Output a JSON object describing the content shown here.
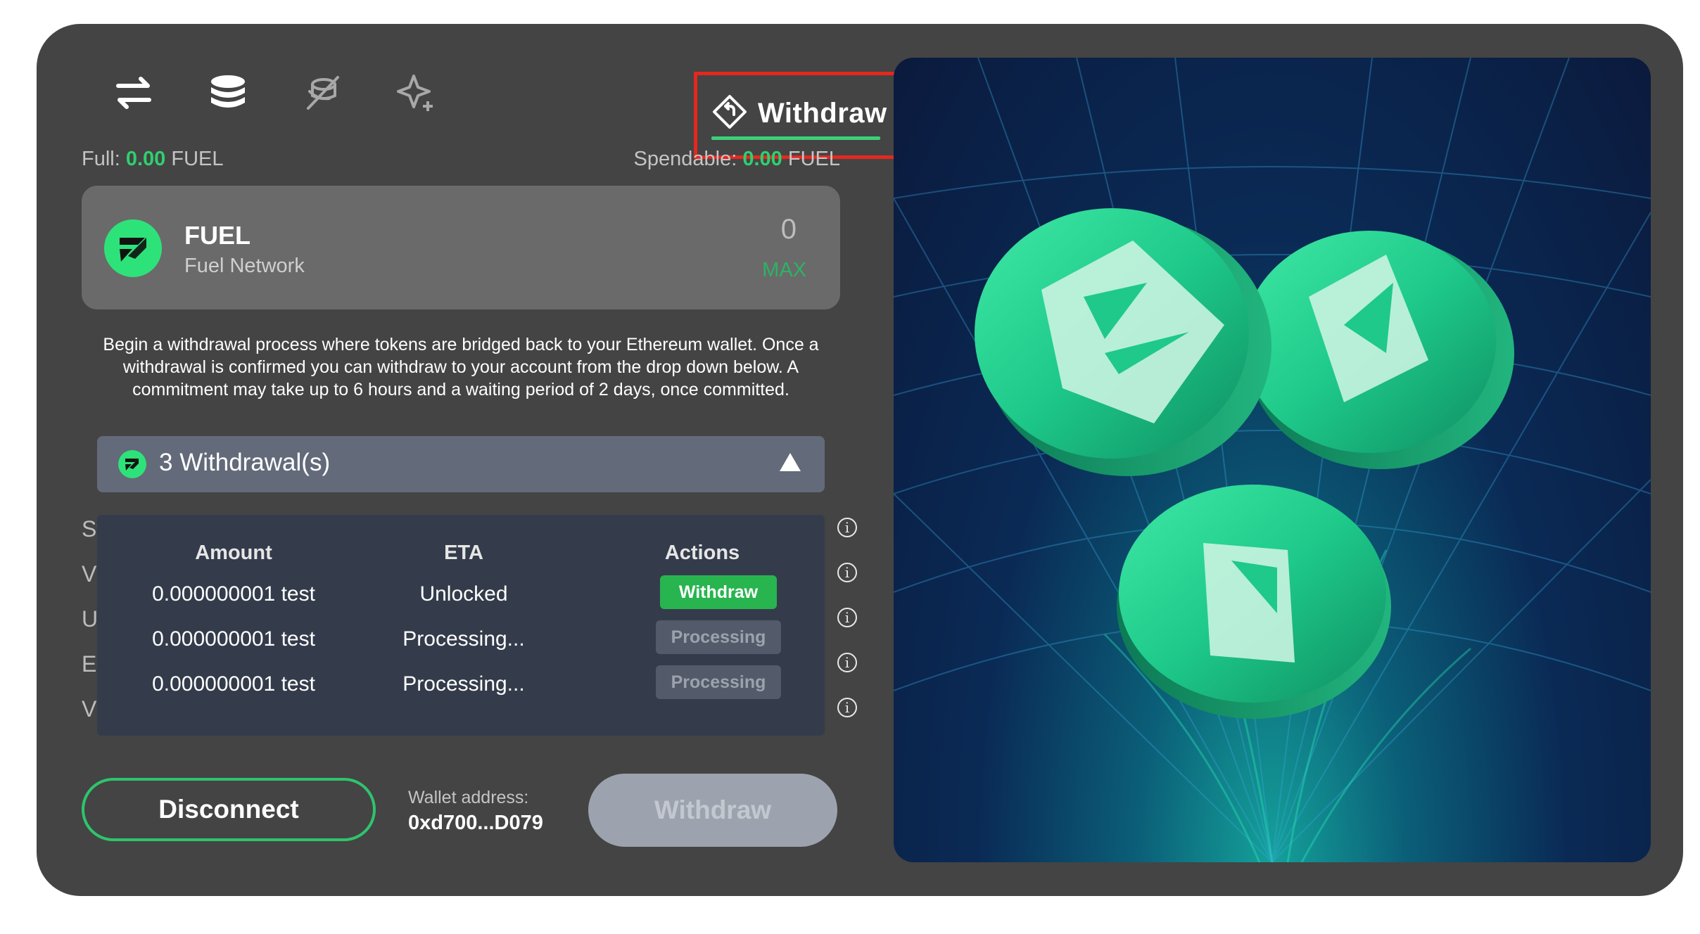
{
  "tabs": [
    {
      "icon": "swap-arrows-icon"
    },
    {
      "icon": "coin-stack-icon"
    },
    {
      "icon": "slashed-coins-icon"
    },
    {
      "icon": "sparkle-star-icon"
    },
    {
      "icon": "withdraw-diamond-icon",
      "label": "Withdraw",
      "active": true
    }
  ],
  "balances": {
    "full_label": "Full:",
    "full_value": "0.00",
    "full_unit": "FUEL",
    "spendable_label": "Spendable:",
    "spendable_value": "0.00",
    "spendable_unit": "FUEL"
  },
  "token": {
    "name": "FUEL",
    "network": "Fuel Network",
    "amount": "0",
    "max_label": "MAX"
  },
  "description": "Begin a withdrawal process where tokens are bridged back to your Ethereum wallet. Once a withdrawal is confirmed you can withdraw to your account from the drop down below. A commitment may take up to 6 hours and a waiting period of 2 days, once committed.",
  "withdrawals_dropdown": {
    "label": "3 Withdrawal(s)",
    "expanded": true
  },
  "background_rows": [
    "St",
    "V",
    "U",
    "Es",
    "V"
  ],
  "withdrawals_table": {
    "headers": {
      "amount": "Amount",
      "eta": "ETA",
      "actions": "Actions"
    },
    "rows": [
      {
        "amount": "0.000000001 test",
        "eta": "Unlocked",
        "action": "Withdraw",
        "enabled": true
      },
      {
        "amount": "0.000000001 test",
        "eta": "Processing...",
        "action": "Processing",
        "enabled": false
      },
      {
        "amount": "0.000000001 test",
        "eta": "Processing...",
        "action": "Processing",
        "enabled": false
      }
    ]
  },
  "footer": {
    "disconnect_label": "Disconnect",
    "wallet_label": "Wallet address:",
    "wallet_address": "0xd700...D079",
    "withdraw_label": "Withdraw"
  },
  "colors": {
    "accent_green": "#2ed06e",
    "card_bg": "#444444",
    "highlight_border": "#e5281f"
  }
}
